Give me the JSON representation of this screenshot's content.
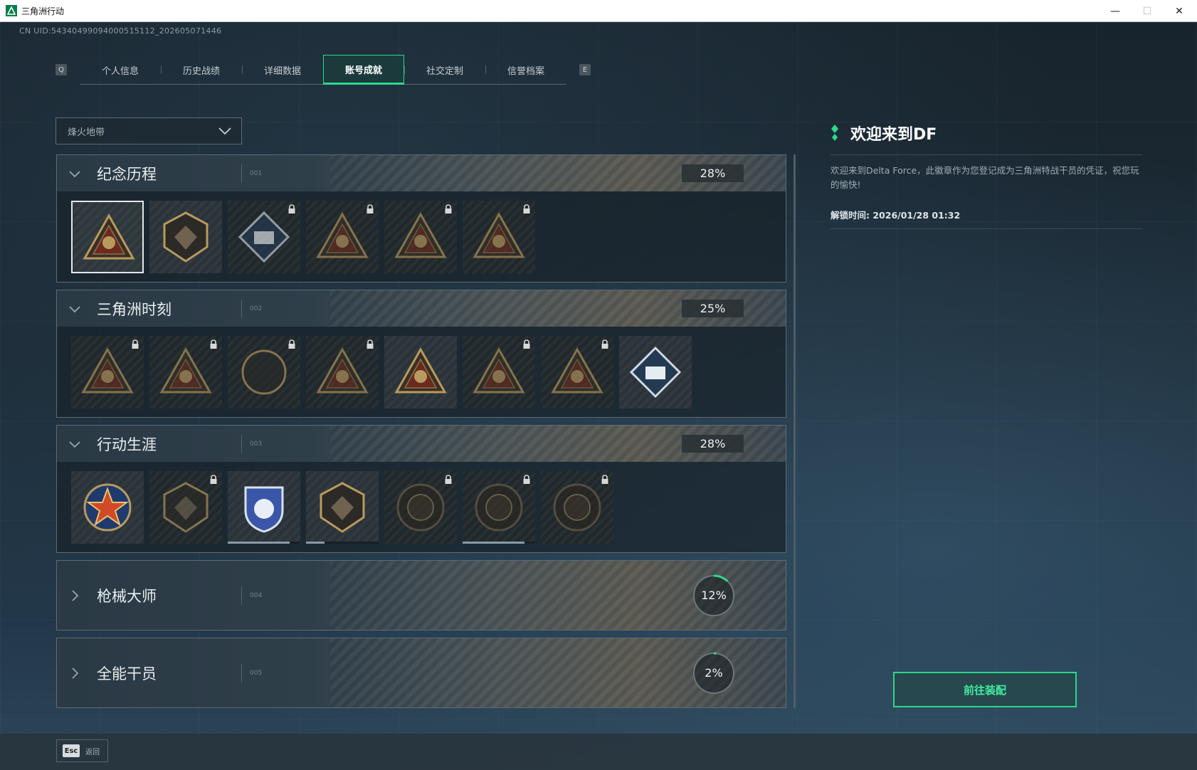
{
  "window": {
    "title": "三角洲行动"
  },
  "uid_text": "CN UID:54340499094000515112_202605071446",
  "tabs": {
    "q_key": "Q",
    "e_key": "E",
    "items": [
      "个人信息",
      "历史战绩",
      "详细数据",
      "账号成就",
      "社交定制",
      "信誉档案"
    ],
    "active": 3
  },
  "filter": {
    "selected": "烽火地带"
  },
  "sections": [
    {
      "title": "纪念历程",
      "index": "001",
      "progress": "28%",
      "expanded": true,
      "badges": [
        {
          "icon": "delta-triangle-emblem",
          "locked": false,
          "selected": true
        },
        {
          "icon": "helicopter-emblem",
          "locked": false
        },
        {
          "icon": "shield-diamond-emblem",
          "locked": true
        },
        {
          "icon": "soldier-cross-emblem",
          "locked": true
        },
        {
          "icon": "hooded-figure-emblem",
          "locked": true
        },
        {
          "icon": "skull-rifles-emblem",
          "locked": true
        }
      ]
    },
    {
      "title": "三角洲时刻",
      "index": "002",
      "progress": "25%",
      "expanded": true,
      "badges": [
        {
          "icon": "robot-triangle-emblem",
          "locked": true
        },
        {
          "icon": "helmet-triangle-emblem",
          "locked": true
        },
        {
          "icon": "kneeling-soldier-emblem",
          "locked": true
        },
        {
          "icon": "crosshair-triangle-emblem",
          "locked": true
        },
        {
          "icon": "squad-triangle-emblem",
          "locked": false
        },
        {
          "icon": "eagle-triangle-emblem",
          "locked": true
        },
        {
          "icon": "fish-triangle-emblem",
          "locked": true
        },
        {
          "icon": "book-diamond-emblem",
          "locked": false
        }
      ]
    },
    {
      "title": "行动生涯",
      "index": "003",
      "progress": "28%",
      "expanded": true,
      "badges": [
        {
          "icon": "star-medal-emblem",
          "locked": false
        },
        {
          "icon": "shield-chevron-emblem",
          "locked": true
        },
        {
          "icon": "blue-shield-emblem",
          "locked": false,
          "progress": 0.85
        },
        {
          "icon": "gem-shield-emblem",
          "locked": false,
          "progress": 0.25
        },
        {
          "icon": "circle-emblem",
          "locked": true
        },
        {
          "icon": "skull-circle-emblem",
          "locked": true,
          "progress": 0.85
        },
        {
          "icon": "eye-circle-emblem",
          "locked": true
        }
      ]
    },
    {
      "title": "枪械大师",
      "index": "004",
      "progress": "12%",
      "progress_value": 0.12,
      "expanded": false
    },
    {
      "title": "全能干员",
      "index": "005",
      "progress": "2%",
      "progress_value": 0.02,
      "expanded": false
    }
  ],
  "detail": {
    "name": "欢迎来到DF",
    "description": "欢迎来到Delta Force，此徽章作为您登记成为三角洲特战干员的凭证，祝您玩的愉快!",
    "unlock_time": "解锁时间: 2026/01/28 01:32"
  },
  "equip_button": "前往装配",
  "esc": {
    "key": "Esc",
    "label": "返回"
  },
  "colors": {
    "accent": "#2bd98a",
    "gold": "#b89a5e"
  }
}
